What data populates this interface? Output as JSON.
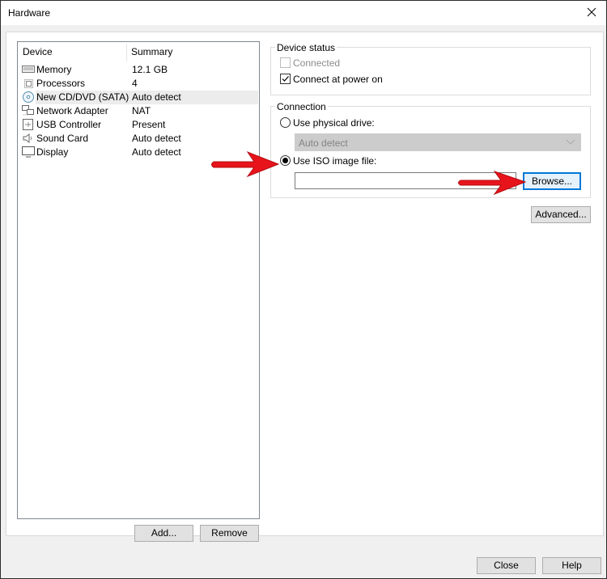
{
  "window": {
    "title": "Hardware",
    "close_icon": "close-icon"
  },
  "device_list": {
    "headers": {
      "device": "Device",
      "summary": "Summary"
    },
    "rows": [
      {
        "icon": "memory-icon",
        "device": "Memory",
        "summary": "12.1 GB",
        "selected": false
      },
      {
        "icon": "processor-icon",
        "device": "Processors",
        "summary": "4",
        "selected": false
      },
      {
        "icon": "cd-dvd-icon",
        "device": "New CD/DVD (SATA)",
        "summary": "Auto detect",
        "selected": true
      },
      {
        "icon": "network-adapter-icon",
        "device": "Network Adapter",
        "summary": "NAT",
        "selected": false
      },
      {
        "icon": "usb-icon",
        "device": "USB Controller",
        "summary": "Present",
        "selected": false
      },
      {
        "icon": "sound-icon",
        "device": "Sound Card",
        "summary": "Auto detect",
        "selected": false
      },
      {
        "icon": "display-icon",
        "device": "Display",
        "summary": "Auto detect",
        "selected": false
      }
    ],
    "add_label": "Add...",
    "remove_label": "Remove"
  },
  "device_status": {
    "legend": "Device status",
    "connected": {
      "label": "Connected",
      "checked": false,
      "disabled": true
    },
    "connect_at_power_on": {
      "label": "Connect at power on",
      "checked": true,
      "disabled": false
    }
  },
  "connection": {
    "legend": "Connection",
    "physical_drive": {
      "label": "Use physical drive:",
      "selected": false,
      "dropdown_value": "Auto detect"
    },
    "iso_image": {
      "label": "Use ISO image file:",
      "selected": true,
      "path_value": "",
      "browse_label": "Browse..."
    }
  },
  "advanced_label": "Advanced...",
  "footer": {
    "close_label": "Close",
    "help_label": "Help"
  },
  "annotations": {
    "arrow_color": "#e8141b",
    "arrows": [
      "arrow-to-iso-radio",
      "arrow-to-browse-button"
    ]
  }
}
